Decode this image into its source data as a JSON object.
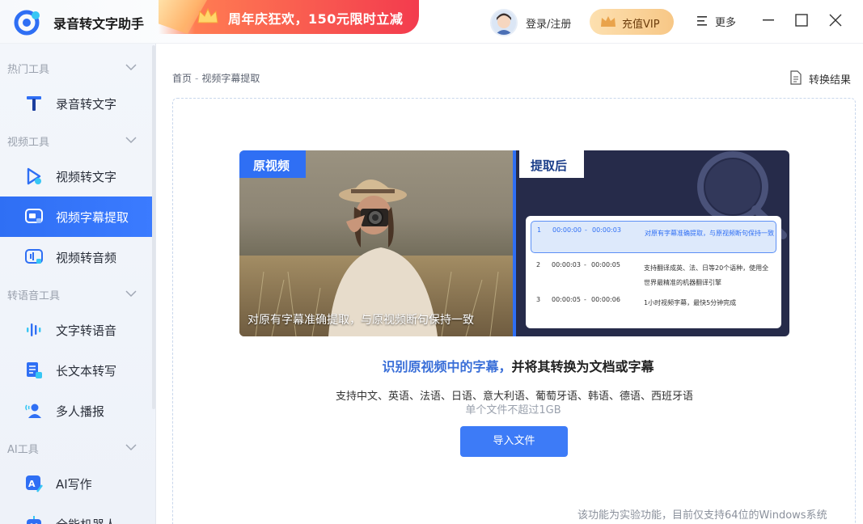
{
  "app": {
    "name": "录音转文字助手",
    "promo_text": "周年庆狂欢，150元限时立减",
    "login_label": "登录/注册",
    "vip_label": "充值VIP",
    "more_label": "更多"
  },
  "sidebar": {
    "groups": [
      {
        "label": "热门工具",
        "items": [
          {
            "label": "录音转文字",
            "icon": "t-letter-icon"
          }
        ]
      },
      {
        "label": "视频工具",
        "items": [
          {
            "label": "视频转文字",
            "icon": "video-play-icon"
          },
          {
            "label": "视频字幕提取",
            "icon": "subtitle-extract-icon",
            "active": true
          },
          {
            "label": "视频转音频",
            "icon": "video-audio-icon"
          }
        ]
      },
      {
        "label": "转语音工具",
        "items": [
          {
            "label": "文字转语音",
            "icon": "sound-wave-icon"
          },
          {
            "label": "长文本转写",
            "icon": "long-text-icon"
          },
          {
            "label": "多人播报",
            "icon": "multi-speaker-icon"
          }
        ]
      },
      {
        "label": "AI工具",
        "items": [
          {
            "label": "AI写作",
            "icon": "ai-write-icon"
          },
          {
            "label": "全能机器人",
            "icon": "robot-icon"
          }
        ]
      }
    ]
  },
  "main": {
    "breadcrumb": {
      "home": "首页",
      "sep": "-",
      "current": "视频字幕提取"
    },
    "result_label": "转换结果",
    "demo": {
      "orig_tag": "原视频",
      "after_tag": "提取后",
      "caption": "对原有字幕准确提取，与原视频断句保持一致",
      "subtitles": [
        {
          "num": "1",
          "start": "00:00:00",
          "dash": "-",
          "end": "00:00:03",
          "text": "对原有字幕准确提取，与原视频断句保持一致"
        },
        {
          "num": "2",
          "start": "00:00:03",
          "dash": "-",
          "end": "00:00:05",
          "text": "支持翻译成英、法、日等20个语种，使用全世界最精准的机器翻译引擎"
        },
        {
          "num": "3",
          "start": "00:00:05",
          "dash": "-",
          "end": "00:00:06",
          "text": "1小时视频字幕，最快5分钟完成"
        }
      ]
    },
    "headline_blue": "识别原视频中的字幕，",
    "headline_rest": "并将其转换为文档或字幕",
    "languages": "支持中文、英语、法语、日语、意大利语、葡萄牙语、韩语、德语、西班牙语",
    "size_limit": "单个文件不超过1GB",
    "import_label": "导入文件",
    "footer_note": "该功能为实验功能，目前仅支持64位的Windows系统"
  },
  "colors": {
    "primary": "#2f6ff4",
    "promo_red": "#f33b4e",
    "vip_gold": "#f7c786",
    "demo_dark": "#262b4a"
  }
}
